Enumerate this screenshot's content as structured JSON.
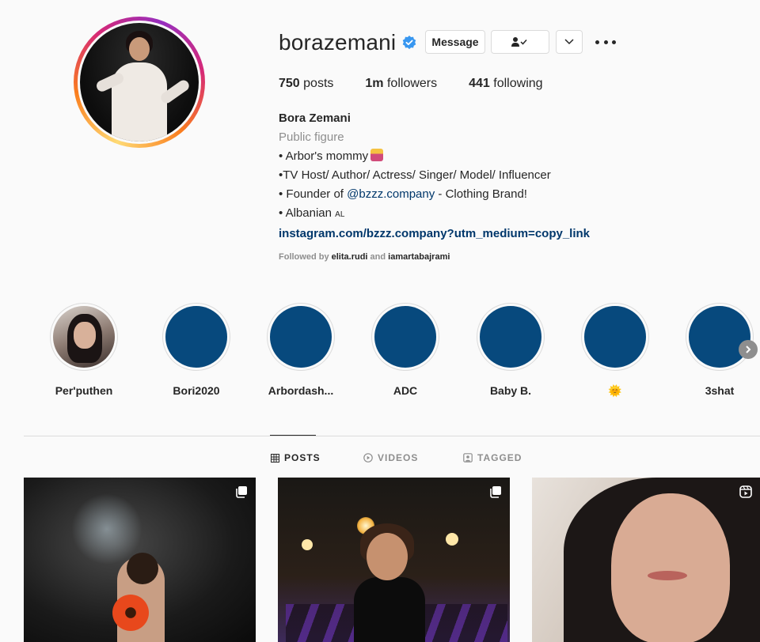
{
  "profile": {
    "username": "borazemani",
    "verified": true,
    "buttons": {
      "message": "Message"
    },
    "stats": {
      "posts_value": "750",
      "posts_label": "posts",
      "followers_value": "1m",
      "followers_label": "followers",
      "following_value": "441",
      "following_label": "following"
    },
    "bio": {
      "full_name": "Bora Zemani",
      "category": "Public figure",
      "line1": "• Arbor's mommy",
      "line2": "•TV Host/ Author/ Actress/ Singer/ Model/ Influencer",
      "line3_prefix": "• Founder of ",
      "line3_mention": "@bzzz.company",
      "line3_suffix": " - Clothing Brand!",
      "line4": "• Albanian",
      "line4_flag": "AL",
      "link": "instagram.com/bzzz.company?utm_medium=copy_link"
    },
    "followed_by": {
      "prefix": "Followed by",
      "account1": "elita.rudi",
      "and": "and",
      "account2": "iamartabajrami"
    }
  },
  "highlights": [
    {
      "label": "Per'puthen"
    },
    {
      "label": "Bori2020"
    },
    {
      "label": "Arbordash..."
    },
    {
      "label": "ADC"
    },
    {
      "label": "Baby B."
    },
    {
      "label": "🌞"
    },
    {
      "label": "3shat"
    }
  ],
  "tabs": {
    "posts": "POSTS",
    "videos": "VIDEOS",
    "tagged": "TAGGED"
  },
  "colors": {
    "link": "#00376b",
    "verified": "#3897f0",
    "highlight_fill": "#07497d"
  }
}
